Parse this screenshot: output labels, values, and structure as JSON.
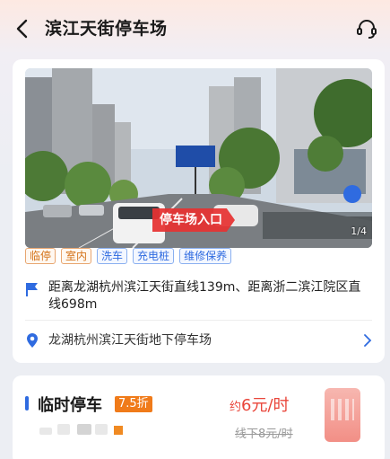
{
  "header": {
    "title": "滨江天街停车场",
    "back_icon": "chevron-left-icon",
    "support_icon": "headset-icon"
  },
  "photo": {
    "sign_text": "停车场入口",
    "counter": "1/4"
  },
  "tags": [
    {
      "label": "临停",
      "color": "#d4731a"
    },
    {
      "label": "室内",
      "color": "#d4731a"
    },
    {
      "label": "洗车",
      "color": "#2f6be0"
    },
    {
      "label": "充电桩",
      "color": "#2f6be0"
    },
    {
      "label": "维修保养",
      "color": "#2f6be0"
    }
  ],
  "location": {
    "distance": "距离龙湖杭州滨江天街直线139m、距离浙二滨江院区直线698m",
    "address": "龙湖杭州滨江天街地下停车场"
  },
  "rate": {
    "title": "临时停车",
    "discount": "7.5折",
    "price_prefix": "约",
    "price_value": "6",
    "price_unit": "元/时",
    "original_price": "线下8元/时"
  },
  "colors": {
    "accent_blue": "#2f6be0",
    "price_red": "#e9453a",
    "discount_orange": "#f07b1a"
  }
}
